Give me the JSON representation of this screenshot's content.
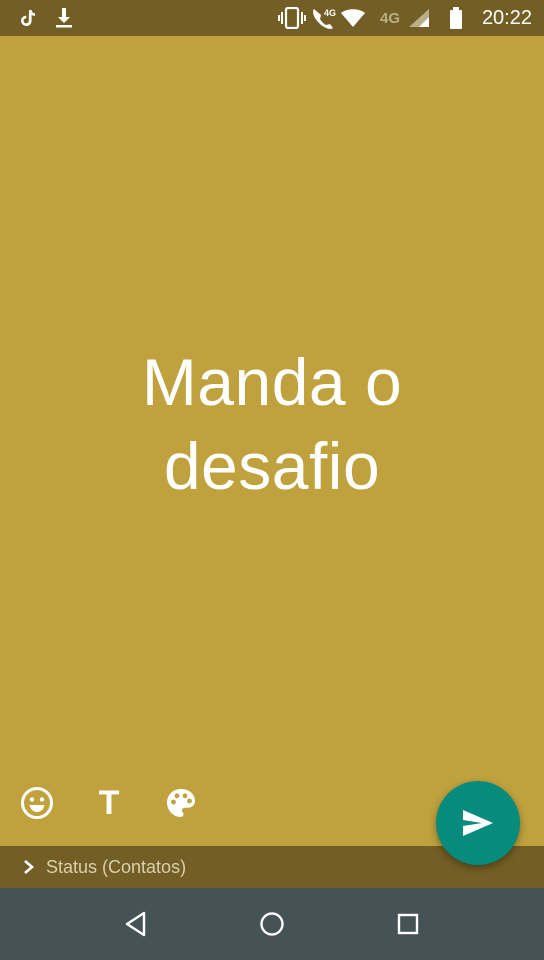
{
  "status_bar": {
    "time": "20:22",
    "network_label_1": "4G",
    "network_label_2": "4G",
    "icons": [
      "tiktok-icon",
      "download-icon",
      "vibrate-icon",
      "wifi-calling-icon",
      "wifi-icon",
      "signal-icon",
      "battery-icon"
    ]
  },
  "editor": {
    "status_text": "Manda o desafio",
    "background_color": "#BFA23E"
  },
  "toolbar": {
    "emoji": "emoji-icon",
    "text_style": "T",
    "color": "palette-icon"
  },
  "send_button": {
    "icon": "send-icon",
    "color": "#068B7D"
  },
  "audience": {
    "label": "Status (Contatos)"
  },
  "nav_bar": {
    "buttons": [
      "back-icon",
      "home-icon",
      "recents-icon"
    ]
  }
}
